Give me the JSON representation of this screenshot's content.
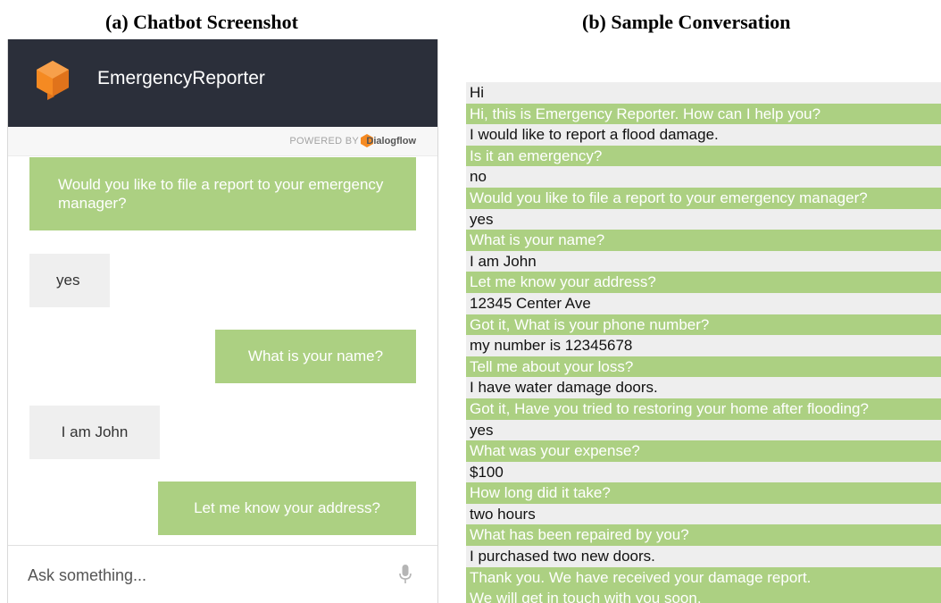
{
  "captions": {
    "a": "(a) Chatbot Screenshot",
    "b": "(b) Sample Conversation"
  },
  "chatbot": {
    "title": "EmergencyReporter",
    "powered_by": "POWERED BY",
    "powered_name": "Dialogflow",
    "messages": [
      {
        "role": "bot",
        "text": "Would you like to file a report to your emergency manager?"
      },
      {
        "role": "user",
        "text": "yes"
      },
      {
        "role": "bot",
        "text": "What is your name?"
      },
      {
        "role": "user",
        "text": "I am John"
      },
      {
        "role": "bot",
        "text": "Let me know your address?"
      }
    ],
    "input": {
      "placeholder": "Ask something...",
      "value": ""
    },
    "icons": {
      "logo": "dialogflow-logo-icon",
      "mic": "microphone-icon"
    },
    "colors": {
      "header": "#2b2f3a",
      "bot_bubble": "#acd082",
      "user_bubble": "#efefef",
      "logo": "#f58a22"
    }
  },
  "conversation": [
    {
      "role": "user",
      "text": "Hi"
    },
    {
      "role": "bot",
      "text": "Hi, this is Emergency Reporter. How can I help you?"
    },
    {
      "role": "user",
      "text": "I would like to report a flood damage."
    },
    {
      "role": "bot",
      "text": "Is it an emergency?"
    },
    {
      "role": "user",
      "text": "no"
    },
    {
      "role": "bot",
      "text": "Would you like to file a report to your emergency manager?"
    },
    {
      "role": "user",
      "text": "yes"
    },
    {
      "role": "bot",
      "text": "What is your name?"
    },
    {
      "role": "user",
      "text": "I am John"
    },
    {
      "role": "bot",
      "text": "Let me know your address?"
    },
    {
      "role": "user",
      "text": "12345 Center Ave"
    },
    {
      "role": "bot",
      "text": "Got it, What is your phone number?"
    },
    {
      "role": "user",
      "text": "my number is 12345678"
    },
    {
      "role": "bot",
      "text": "Tell me about your loss?"
    },
    {
      "role": "user",
      "text": "I have water damage doors."
    },
    {
      "role": "bot",
      "text": "Got it, Have you tried to restoring your home after flooding?"
    },
    {
      "role": "user",
      "text": "yes"
    },
    {
      "role": "bot",
      "text": "What was your expense?"
    },
    {
      "role": "user",
      "text": "$100"
    },
    {
      "role": "bot",
      "text": "How long did it take?"
    },
    {
      "role": "user",
      "text": "two hours"
    },
    {
      "role": "bot",
      "text": "What has been repaired by you?"
    },
    {
      "role": "user",
      "text": "I purchased two new doors."
    },
    {
      "role": "bot",
      "text": "Thank you. We have received your damage report."
    },
    {
      "role": "bot",
      "text": "We will get in touch with you soon."
    }
  ]
}
